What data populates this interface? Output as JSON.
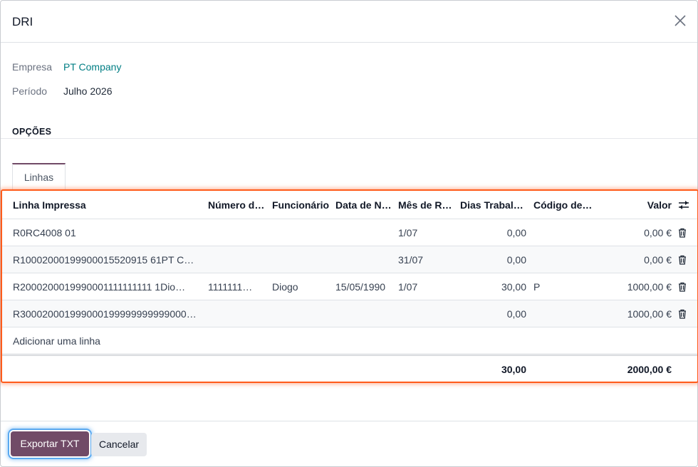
{
  "dialog": {
    "title": "DRI"
  },
  "fields": {
    "empresa_label": "Empresa",
    "empresa_value": "PT Company",
    "periodo_label": "Período",
    "periodo_value": "Julho 2026"
  },
  "section": {
    "title": "OPÇÕES"
  },
  "tabs": [
    {
      "label": "Linhas"
    }
  ],
  "table": {
    "columns": [
      "Linha Impressa",
      "Número d…",
      "Funcionário",
      "Data de N…",
      "Mês de R…",
      "Dias Trabalh…",
      "Código de…",
      "Valor"
    ],
    "rows": [
      [
        "R0RC4008 01",
        "",
        "",
        "",
        "1/07",
        "0,00",
        "",
        "0,00 €"
      ],
      [
        "R10002000199900015520915 61PT Co…",
        "",
        "",
        "",
        "31/07",
        "0,00",
        "",
        "0,00 €"
      ],
      [
        "R2000200019990001111111111 1Dio…",
        "1111111…",
        "Diogo",
        "15/05/1990",
        "1/07",
        "30,00",
        "P",
        "1000,00 €"
      ],
      [
        "R300020001999000199999999999000…",
        "",
        "",
        "",
        "",
        "0,00",
        "",
        "1000,00 €"
      ]
    ],
    "add_line": "Adicionar uma linha",
    "totals": {
      "dias": "30,00",
      "valor": "2000,00 €"
    }
  },
  "footer": {
    "export_label": "Exportar TXT",
    "cancel_label": "Cancelar"
  },
  "colors": {
    "primary": "#714b67",
    "link": "#017e84",
    "highlight": "#ff5b1a"
  }
}
